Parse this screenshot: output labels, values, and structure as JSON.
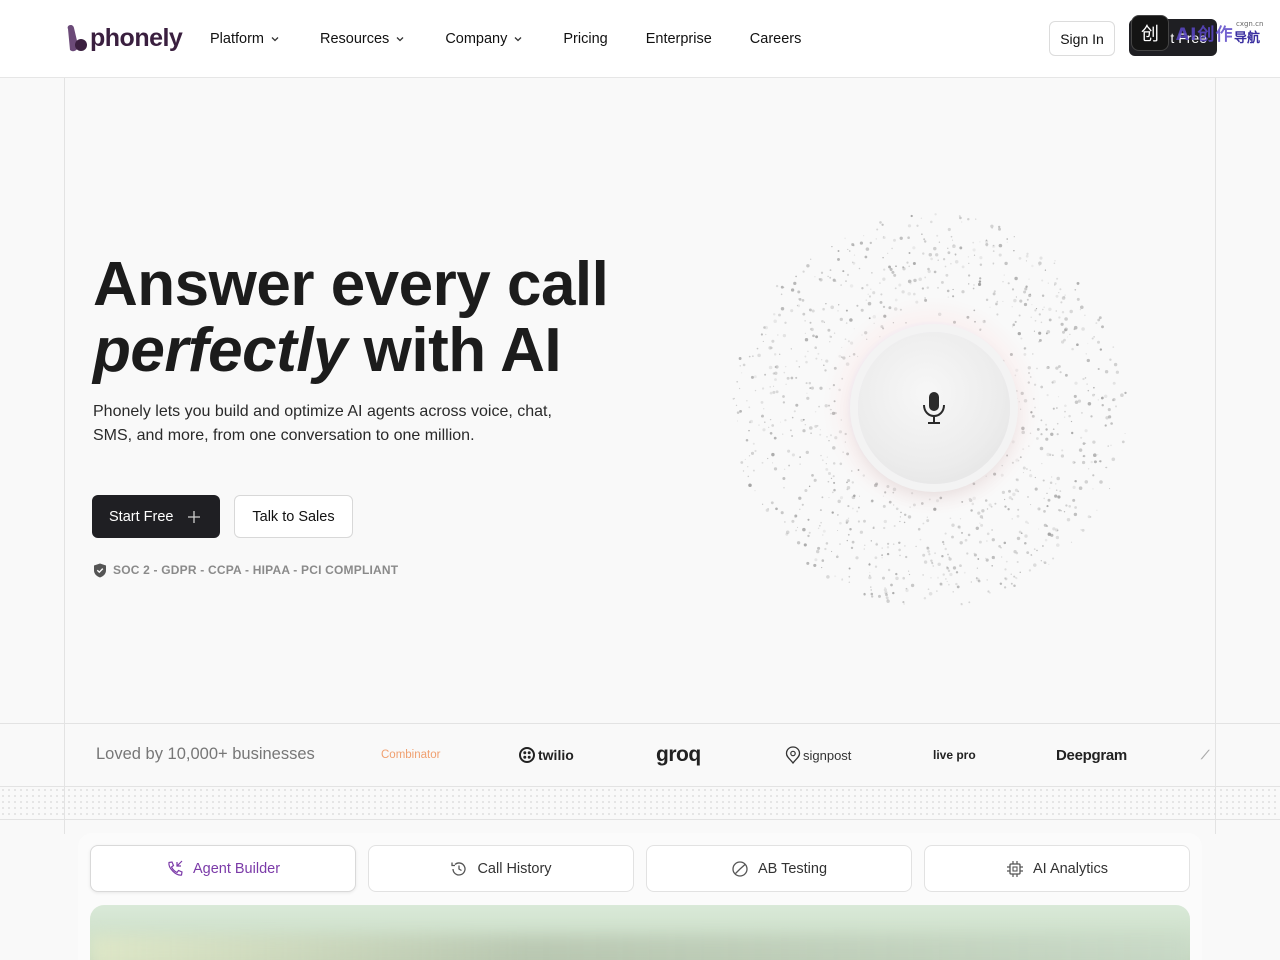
{
  "brand": {
    "name": "phonely"
  },
  "nav": {
    "items": [
      {
        "label": "Platform",
        "dropdown": true
      },
      {
        "label": "Resources",
        "dropdown": true
      },
      {
        "label": "Company",
        "dropdown": true
      },
      {
        "label": "Pricing",
        "dropdown": false
      },
      {
        "label": "Enterprise",
        "dropdown": false
      },
      {
        "label": "Careers",
        "dropdown": false
      }
    ],
    "sign_in": "Sign In",
    "start_free": "t Free"
  },
  "watermark": {
    "icon_glyph": "创",
    "text": "AI创作",
    "sub": "导航",
    "url": "cxgn.cn"
  },
  "hero": {
    "title_line1": "Answer every call",
    "title_italic": "perfectly",
    "title_line2_rest": " with AI",
    "subtitle": "Phonely lets you build and optimize AI agents across voice, chat, SMS, and more, from one conversation to one million.",
    "primary_cta": "Start Free",
    "secondary_cta": "Talk to Sales",
    "compliance": "SOC 2 - GDPR - CCPA - HIPAA - PCI COMPLIANT"
  },
  "social_proof": {
    "label": "Loved by 10,000+ businesses",
    "logos": [
      "Combinator",
      "twilio",
      "groq",
      "signpost",
      "live pro",
      "Deepgram"
    ]
  },
  "tabs": [
    {
      "label": "Agent Builder",
      "icon": "phone-icon",
      "active": true
    },
    {
      "label": "Call History",
      "icon": "history-icon",
      "active": false
    },
    {
      "label": "AB Testing",
      "icon": "pie-icon",
      "active": false
    },
    {
      "label": "AI Analytics",
      "icon": "chip-icon",
      "active": false
    }
  ],
  "colors": {
    "accent": "#7b3aa8",
    "primary_button": "#1f1f23",
    "brand_text": "#3a1f3f",
    "background": "#f9f9f9"
  }
}
